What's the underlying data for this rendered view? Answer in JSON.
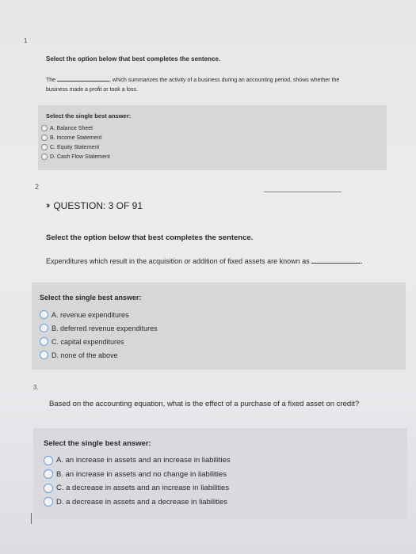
{
  "q1": {
    "number": "1",
    "prompt": "Select the option below that best completes the sentence.",
    "sentence_start": "The",
    "sentence_mid": ", which summarizes the activity of a business during an accounting period, shows whether the",
    "sentence_end": "business made a profit or took a loss.",
    "answer_title": "Select the single best answer:",
    "options": [
      "A. Balance Sheet",
      "B. Income Statement",
      "C. Equity Statement",
      "D. Cash Flow Statement"
    ]
  },
  "q2": {
    "number": "2",
    "header_icon": "double-chevron-right-icon",
    "header_text": "QUESTION: 3 OF 91",
    "prompt": "Select the option below that best completes the sentence.",
    "sentence": "Expenditures which result in the acquisition or addition of fixed assets are known as",
    "answer_title": "Select the single best answer:",
    "options": [
      "A. revenue expenditures",
      "B. deferred revenue expenditures",
      "C. capital expenditures",
      "D. none of the above"
    ]
  },
  "q3": {
    "number": "3.",
    "prompt": "Based on the accounting equation, what is the effect of a purchase of a fixed asset on credit?",
    "answer_title": "Select the single best answer:",
    "options": [
      "A. an increase in assets and an increase in liabilities",
      "B. an increase in assets and no change in liabilities",
      "C. a decrease in assets and an increase in liabilities",
      "D. a decrease in assets and a decrease in liabilities"
    ]
  }
}
